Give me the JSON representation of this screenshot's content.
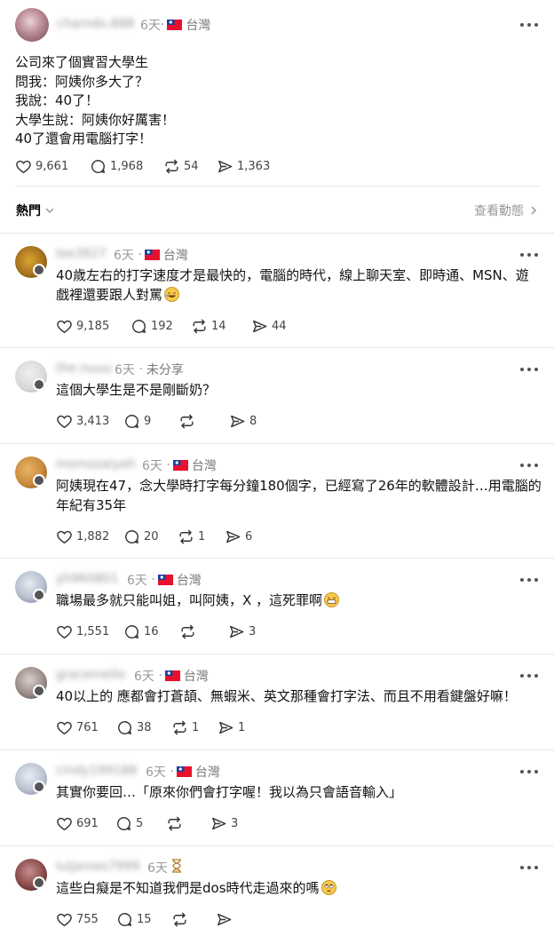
{
  "main_post": {
    "username": "chamdo.888",
    "time": "6天",
    "region": "台灣",
    "lines": [
      "公司來了個實習大學生",
      "問我：阿姨你多大了？",
      "我說：40了！",
      "大學生說：阿姨你好厲害！",
      "40了還會用電腦打字！"
    ],
    "likes": "9,661",
    "comments": "1,968",
    "reposts": "54",
    "shares": "1,363"
  },
  "sort": {
    "label": "熱門",
    "view_activity": "查看動態"
  },
  "replies": [
    {
      "username": "lee3927",
      "time": "6天",
      "region": "台灣",
      "lines": [
        "40歲左右的打字速度才是最快的，電腦的時代，線上聊天室、即時通、MSN、遊",
        "戲裡還要跟人對罵"
      ],
      "emoji": "rofl",
      "likes": "9,185",
      "comments": "192",
      "reposts": "14",
      "shares": "44"
    },
    {
      "username": "the.nuuu",
      "time": "6天",
      "region": "未分享",
      "lines": [
        "這個大學生是不是剛斷奶？"
      ],
      "likes": "3,413",
      "comments": "9",
      "reposts": "",
      "shares": "8"
    },
    {
      "username": "momozaiyeh",
      "time": "6天",
      "region": "台灣",
      "lines": [
        "阿姨現在47，念大學時打字每分鐘180個字，已經寫了26年的軟體設計…用電腦的",
        "年紀有35年"
      ],
      "likes": "1,882",
      "comments": "20",
      "reposts": "1",
      "shares": "6"
    },
    {
      "username": "yh960801",
      "time": "6天",
      "region": "台灣",
      "lines": [
        "職場最多就只能叫姐，叫阿姨，X ，這死罪啊"
      ],
      "emoji": "grin",
      "likes": "1,551",
      "comments": "16",
      "reposts": "",
      "shares": "3"
    },
    {
      "username": "gracemello",
      "time": "6天",
      "region": "台灣",
      "lines": [
        "40以上的 應都會打蒼頡、無蝦米、英文那種會打字法、而且不用看鍵盤好嘛！"
      ],
      "likes": "761",
      "comments": "38",
      "reposts": "1",
      "shares": "1"
    },
    {
      "username": "cindy199188",
      "time": "6天",
      "region": "台灣",
      "lines": [
        "其實你要回…「原來你們會打字喔！我以為只會語音輸入」"
      ],
      "likes": "691",
      "comments": "5",
      "reposts": "",
      "shares": "3"
    },
    {
      "username": "luljames7999",
      "time": "6天",
      "region": "",
      "lines": [
        "這些白癡是不知道我們是dos時代走過來的嗎"
      ],
      "emoji": "eyeroll",
      "likes": "755",
      "comments": "15",
      "reposts": "",
      "shares": ""
    }
  ],
  "colors": {
    "flag_red": "#e8112d",
    "flag_blue": "#1b3fa0",
    "muted": "#999999"
  }
}
